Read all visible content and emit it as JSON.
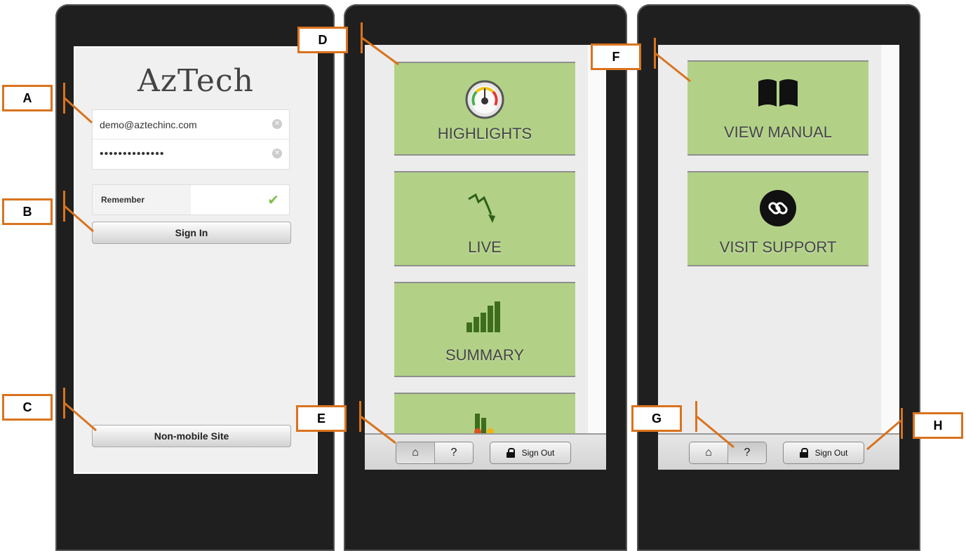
{
  "login_screen": {
    "logo": "AzTech",
    "email_value": "demo@aztechinc.com",
    "password_value": "••••••••••••••",
    "remember_label": "Remember",
    "sign_in_label": "Sign In",
    "non_mobile_label": "Non-mobile Site"
  },
  "home_screen": {
    "tiles": [
      {
        "label": "HIGHLIGHTS",
        "icon": "gauge-icon"
      },
      {
        "label": "LIVE",
        "icon": "trend-down-icon"
      },
      {
        "label": "SUMMARY",
        "icon": "bar-chart-icon"
      },
      {
        "label": "",
        "icon": "bar-chart-icon"
      }
    ],
    "toolbar": {
      "home_icon": "home-icon",
      "help_icon": "help-icon",
      "sign_out_label": "Sign Out"
    }
  },
  "help_screen": {
    "tiles": [
      {
        "label": "VIEW MANUAL",
        "icon": "book-icon"
      },
      {
        "label": "VISIT SUPPORT",
        "icon": "link-icon"
      }
    ],
    "toolbar": {
      "home_icon": "home-icon",
      "help_icon": "help-icon",
      "sign_out_label": "Sign Out"
    }
  },
  "callouts": [
    "A",
    "B",
    "C",
    "D",
    "E",
    "F",
    "G",
    "H"
  ],
  "colors": {
    "accent": "#d9731e",
    "tile": "#b2d186",
    "phone": "#1f1f1f"
  }
}
